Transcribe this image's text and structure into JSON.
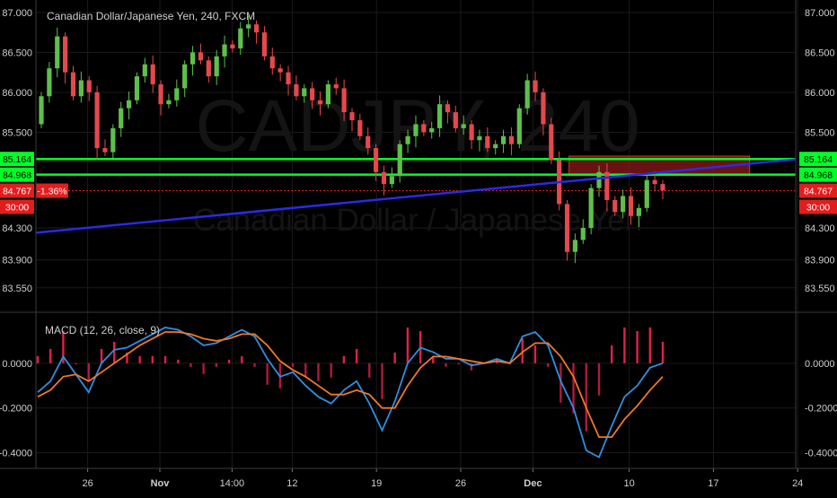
{
  "chart_data": [
    {
      "type": "candlestick",
      "title": "Canadian Dollar/Japanese Yen, 240, FXCM",
      "watermark_symbol": "CADJPY, 240",
      "watermark_name": "Canadian Dollar / Japanese Yen",
      "ylim": [
        83.3,
        87.1
      ],
      "y_ticks": [
        "87.000",
        "86.500",
        "86.000",
        "85.500",
        "84.300",
        "83.900",
        "83.550"
      ],
      "x_ticks": [
        "26",
        "Nov",
        "14:00",
        "12",
        "19",
        "26",
        "Dec",
        "10",
        "17",
        "24"
      ],
      "grid": true,
      "closes": [
        85.95,
        86.3,
        86.7,
        86.25,
        85.95,
        86.15,
        86.0,
        85.3,
        85.25,
        85.55,
        85.8,
        85.9,
        86.2,
        86.35,
        86.1,
        85.85,
        85.9,
        86.05,
        86.35,
        86.5,
        86.4,
        86.2,
        86.45,
        86.6,
        86.55,
        86.8,
        86.85,
        86.75,
        86.45,
        86.3,
        86.25,
        86.1,
        85.95,
        86.05,
        85.9,
        85.85,
        86.1,
        86.05,
        85.75,
        85.65,
        85.45,
        85.3,
        85.0,
        84.85,
        84.95,
        85.35,
        85.45,
        85.6,
        85.5,
        85.55,
        85.85,
        85.75,
        85.55,
        85.6,
        85.4,
        85.45,
        85.3,
        85.35,
        85.45,
        85.35,
        85.8,
        86.15,
        86.0,
        85.6,
        85.15,
        84.6,
        84.0,
        84.15,
        84.3,
        84.8,
        85.0,
        84.65,
        84.5,
        84.7,
        84.45,
        84.55,
        84.9,
        84.85,
        84.77
      ],
      "levels": [
        {
          "label": "85.164",
          "value": 85.164,
          "color": "#00ff26"
        },
        {
          "label": "84.968",
          "value": 84.968,
          "color": "#00ff26"
        }
      ],
      "current_price": {
        "label": "84.767",
        "value": 84.767,
        "change": "-1.36%",
        "timer": "30:00",
        "color": "#e21d1d"
      },
      "trendline": {
        "color": "#2a2ae6",
        "from": [
          "Oct 22",
          84.24
        ],
        "to": [
          "Dec 24",
          85.16
        ]
      },
      "zone": {
        "high": 85.2,
        "low": 84.96,
        "from": "Dec 5",
        "to": "Dec 20",
        "fill": "#8b1a1a",
        "stroke": "#cc3a1a"
      },
      "up_color": "#5ec04a",
      "down_color": "#e5484d"
    },
    {
      "type": "line",
      "title": "MACD (12, 26, close, 9)",
      "ylim": [
        -0.45,
        0.2
      ],
      "y_ticks": [
        "0.0000",
        "-0.2000",
        "-0.4000"
      ],
      "series": [
        {
          "color": "#2f8fe0",
          "values": [
            -0.13,
            -0.08,
            0.03,
            -0.05,
            -0.13,
            0.0,
            0.06,
            0.07,
            0.1,
            0.13,
            0.16,
            0.15,
            0.12,
            0.08,
            0.09,
            0.12,
            0.15,
            0.12,
            0.02,
            -0.06,
            -0.04,
            -0.1,
            -0.15,
            -0.18,
            -0.12,
            -0.08,
            -0.18,
            -0.3,
            -0.17,
            0.0,
            0.07,
            0.05,
            0.02,
            0.02,
            -0.01,
            0.0,
            0.02,
            0.0,
            0.12,
            0.14,
            0.08,
            -0.08,
            -0.2,
            -0.39,
            -0.42,
            -0.28,
            -0.15,
            -0.1,
            -0.02,
            0.0
          ]
        },
        {
          "color": "#f0782a",
          "values": [
            -0.15,
            -0.12,
            -0.06,
            -0.05,
            -0.08,
            -0.04,
            0.0,
            0.04,
            0.08,
            0.11,
            0.14,
            0.14,
            0.13,
            0.11,
            0.1,
            0.11,
            0.13,
            0.13,
            0.08,
            0.01,
            -0.03,
            -0.06,
            -0.1,
            -0.14,
            -0.14,
            -0.12,
            -0.14,
            -0.2,
            -0.2,
            -0.1,
            -0.02,
            0.03,
            0.03,
            0.02,
            0.01,
            0.0,
            0.01,
            0.0,
            0.05,
            0.09,
            0.09,
            0.03,
            -0.06,
            -0.2,
            -0.33,
            -0.33,
            -0.25,
            -0.19,
            -0.12,
            -0.06
          ]
        }
      ],
      "histogram_colors": {
        "positive": "#e0204a",
        "negative": "#b01a3c"
      }
    }
  ]
}
